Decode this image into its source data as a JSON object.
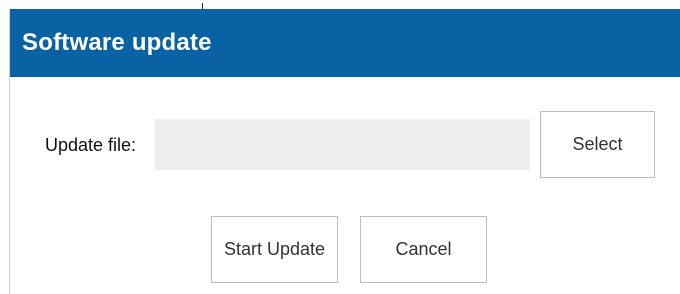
{
  "dialog": {
    "title": "Software update",
    "title_bar_color": "#0962a4",
    "file_row": {
      "label": "Update file:",
      "input_value": "",
      "input_placeholder": "",
      "select_label": "Select"
    },
    "actions": {
      "start_label": "Start Update",
      "cancel_label": "Cancel"
    }
  }
}
